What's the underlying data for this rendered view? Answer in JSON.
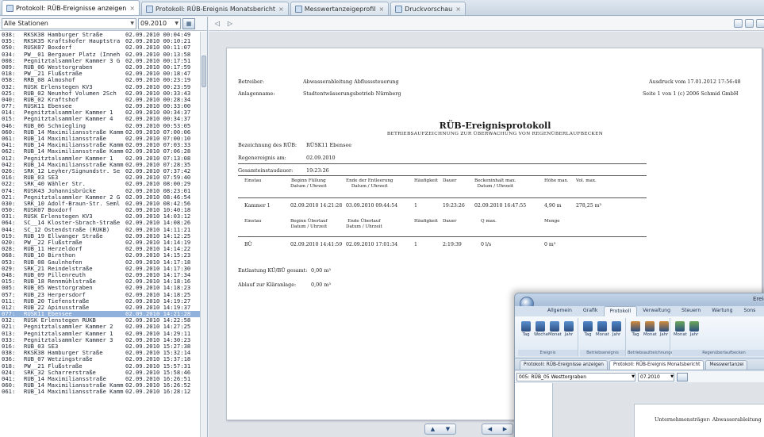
{
  "tabs": [
    {
      "label": "Protokoll: RÜB-Ereignisse anzeigen",
      "active": true
    },
    {
      "label": "Protokoll: RÜB-Ereignis Monatsbericht",
      "active": false
    },
    {
      "label": "Messwertanzeigeprofil",
      "active": false
    },
    {
      "label": "Druckvorschau",
      "active": false
    }
  ],
  "filters": {
    "station": "Alle Stationen",
    "date": "09.2010"
  },
  "event_list": [
    [
      "038:",
      "RKSK38 Hamburger Straße",
      "02.09.2010 00:04:49"
    ],
    [
      "035:",
      "RKSK35 Kraftshofer Hauptstra",
      "02.09.2010 00:10:21"
    ],
    [
      "050:",
      "RÜSK07 Boxdorf",
      "02.09.2010 00:11:07"
    ],
    [
      "034:",
      "PW__01 Bergauer Platz (Inneh",
      "02.09.2010 00:13:58"
    ],
    [
      "008:",
      "Pegnitztalsammler Kammer 3 G",
      "02.09.2010 00:17:51"
    ],
    [
      "009:",
      "RÜB_06 Westtorgraben",
      "02.09.2010 00:17:59"
    ],
    [
      "018:",
      "PW__21 Flußstraße",
      "02.09.2010 00:18:47"
    ],
    [
      "058:",
      "RRB_08 Almoshof",
      "02.09.2010 00:23:19"
    ],
    [
      "032:",
      "RÜSK Erlenstegen KV3",
      "02.09.2010 00:23:59"
    ],
    [
      "025:",
      "RÜB_02 Neunhof Volumen 2Sch",
      "02.09.2010 00:33:43"
    ],
    [
      "040:",
      "RÜB_02 Kraftshof",
      "02.09.2010 00:28:34"
    ],
    [
      "077:",
      "RÜSK11 Ebensee",
      "02.09.2010 00:33:00"
    ],
    [
      "014:",
      "Pegnitztalsammler Kammer 1",
      "02.09.2010 00:34:37"
    ],
    [
      "015:",
      "Pegnitztalsammler Kammer 4",
      "02.09.2010 00:34:37"
    ],
    [
      "046:",
      "RÜB_06 Schniegling",
      "02.09.2010 00:53:05"
    ],
    [
      "060:",
      "RÜB_14 Maximiliansstraße Kamm",
      "02.09.2010 07:00:06"
    ],
    [
      "061:",
      "RÜB_14 Maximiliansstraße",
      "02.09.2010 07:00:10"
    ],
    [
      "041:",
      "RÜB_14 Maximiliansstraße Kamm",
      "02.09.2010 07:03:33"
    ],
    [
      "062:",
      "RÜB_14 Maximiliansstraße Kamm",
      "02.09.2010 07:06:28"
    ],
    [
      "012:",
      "Pegnitztalsammler Kammer 1",
      "02.09.2010 07:13:08"
    ],
    [
      "042:",
      "RÜB_14 Maximiliansstraße Kamm",
      "02.09.2010 07:28:35"
    ],
    [
      "026:",
      "SRK_12 Leyher/Signundstr. Se",
      "02.09.2010 07:37:42"
    ],
    [
      "016:",
      "RÜB_03 SE3",
      "02.09.2010 07:59:40"
    ],
    [
      "022:",
      "SRK_40 Wähler Str.",
      "02.09.2010 08:00:29"
    ],
    [
      "074:",
      "RÜSK43 Johannisbrücke",
      "02.09.2010 08:23:01"
    ],
    [
      "021:",
      "Pegnitztalsammler Kammer 2 G",
      "02.09.2010 08:46:54"
    ],
    [
      "030:",
      "SRK_10 Adolf-Braun-Str. Seml",
      "02.09.2010 08:42:56"
    ],
    [
      "050:",
      "RÜSK07 Boxdorf",
      "02.09.2010 10:40:18"
    ],
    [
      "031:",
      "RÜSK Erlenstegen KV3",
      "02.09.2010 14:03:12"
    ],
    [
      "064:",
      "SC__14 Kloster-Sbrach-Straße",
      "02.09.2010 14:08:26"
    ],
    [
      "044:",
      "SC_12 Ostendstraße (RÜKB)",
      "02.09.2010 14:11:21"
    ],
    [
      "019:",
      "RÜB_19 Ellwanger Straße",
      "02.09.2010 14:12:25"
    ],
    [
      "020:",
      "PW__22 Flußstraße",
      "02.09.2010 14:14:19"
    ],
    [
      "028:",
      "RÜB_11 Herzeldorf",
      "02.09.2010 14:14:22"
    ],
    [
      "068:",
      "RÜB_10 Birnthon",
      "02.09.2010 14:15:23"
    ],
    [
      "053:",
      "RÜB_08 Gaulnhofen",
      "02.09.2010 14:17:18"
    ],
    [
      "029:",
      "SRK_21 Reindelstraße",
      "02.09.2010 14:17:30"
    ],
    [
      "048:",
      "RÜB_09 Pillenreuth",
      "02.09.2010 14:17:34"
    ],
    [
      "015:",
      "RÜB_18 Rennmühlstraße",
      "02.09.2010 14:18:16"
    ],
    [
      "005:",
      "RÜB_05 Westtorgraben",
      "02.09.2010 14:18:23"
    ],
    [
      "057:",
      "RÜB_23 Herpersdorf",
      "02.09.2010 14:18:25"
    ],
    [
      "011:",
      "RÜB_20 Tiefenstraße",
      "02.09.2010 14:19:27"
    ],
    [
      "012:",
      "RÜB_22 Apinusstraße",
      "02.09.2010 14:19:37"
    ],
    [
      "077:",
      "RÜSK11 Ebensee",
      "02.09.2010 14:21:28"
    ],
    [
      "032:",
      "RÜSK Erlenstegen RÜKB",
      "02.09.2010 14:22:58"
    ],
    [
      "021:",
      "Pegnitztalsammler Kammer 2",
      "02.09.2010 14:27:25"
    ],
    [
      "013:",
      "Pegnitztalsammler Kammer 1",
      "02.09.2010 14:29:11"
    ],
    [
      "033:",
      "Pegnitztalsammler Kammer 3",
      "02.09.2010 14:30:23"
    ],
    [
      "016:",
      "RÜB_03 SE3",
      "02.09.2010 15:27:38"
    ],
    [
      "038:",
      "RKSK38 Hamburger Straße",
      "02.09.2010 15:32:14"
    ],
    [
      "036:",
      "RÜB_07 Wetzingstraße",
      "02.09.2010 15:37:18"
    ],
    [
      "018:",
      "PW__21 Flußstraße",
      "02.09.2010 15:57:31"
    ],
    [
      "024:",
      "SRK_32 Scharrerstraße",
      "02.09.2010 15:58:46"
    ],
    [
      "041:",
      "RÜB_14 Maximiliansstraße",
      "02.09.2010 16:26:51"
    ],
    [
      "060:",
      "RÜB_14 Maximiliansstraße Kamm",
      "02.09.2010 16:26:52"
    ],
    [
      "061:",
      "RÜB_14 Maximiliansstraße Kamm",
      "02.09.2010 16:28:12"
    ]
  ],
  "selected_index": 43,
  "report": {
    "betreiber_label": "Betreiber:",
    "betreiber_value": "Abwasserableitung Abflusssteuerung",
    "anlage_label": "Anlagenname:",
    "anlage_value": "Stadtentwässerungsbetrieb Nürnberg",
    "ausdruck": "Ausdruck vom 17.01.2012 17:56:48",
    "seite": "Seite 1 von 1   (c) 2006 Schmid GmbH",
    "title": "RÜB-Ereignisprotokoll",
    "subtitle": "BETRIEBSAUFZEICHNUNG ZUR ÜBERWACHUNG VON REGENÜBERLAUFBECKEN",
    "bez_label": "Bezeichnung des RÜB:",
    "bez_value": "RÜSK11 Ebensee",
    "ereignis_label": "Regenereignis am:",
    "ereignis_value": "02.09.2010",
    "gesamt_label": "Gesamteinstaudauer:",
    "gesamt_value": "19:23:26",
    "t1_headers": [
      "Einstau",
      "Beginn Füllung\nDatum / Uhrzeit",
      "Ende der Entleerung\nDatum / Uhrzeit",
      "Häufigkeit",
      "Dauer",
      "Beckeninhalt max.\nDatum / Uhrzeit",
      "Höhe max.",
      "Vol. max."
    ],
    "t1_row": [
      "Kammer 1",
      "02.09.2010 14:21:28",
      "03.09.2010 09:44:54",
      "1",
      "19:23:26",
      "02.09.2010 16:47:55",
      "4,90 m",
      "278,25 m³"
    ],
    "t2_headers": [
      "Einstau",
      "Beginn Überlauf\nDatum / Uhrzeit",
      "Ende Überlauf\nDatum / Uhrzeit",
      "Häufigkeit",
      "Dauer",
      "Q max.",
      "Menge"
    ],
    "t2_row": [
      "BÜ",
      "02.09.2010 14:41:59",
      "02.09.2010 17:01:34",
      "1",
      "2:19:39",
      "0 l/s",
      "0 m³"
    ],
    "entl_label": "Entlastung KÜ/BÜ gesamt:",
    "entl_value": "0,00 m³",
    "abl_label": "Ablauf zur Kläranlage:",
    "abl_value": "0,00 m³"
  },
  "inset": {
    "title": "Ereigni",
    "ribbon_tabs": [
      "Allgemein",
      "Grafik",
      "Protokoll",
      "Verwaltung",
      "Steuern",
      "Wartung",
      "Sons"
    ],
    "active_ribbon_tab": 2,
    "group_labels": [
      "Ereignis",
      "Betriebsereignis",
      "Betriebsaufzeichnungen",
      "Regenüberlaufbecken"
    ],
    "buttons": [
      "Tag",
      "Woche",
      "Monat",
      "Jahr",
      "Tag",
      "Monat",
      "Jahr",
      "Tag",
      "Monat",
      "Jahr",
      "Monat",
      "Jahr"
    ],
    "tabs": [
      "Protokoll: RÜB-Ereignisse anzeigen",
      "Protokoll: RÜB-Ereignis Monatsbericht",
      "Messwertanzei"
    ],
    "station": "005: RÜB_05 Westtorgraben",
    "date": "07.2010",
    "page_label": "Unternehmensträger:   Abwasserableitung"
  }
}
